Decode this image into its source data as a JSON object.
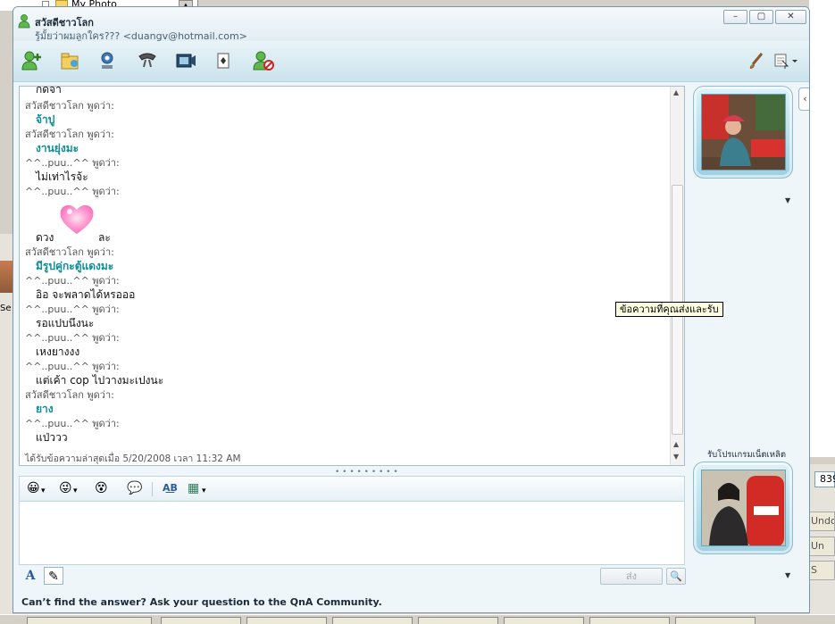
{
  "background": {
    "tree_item": "My Photo",
    "right_field_value": "839",
    "right_buttons": [
      "Undo",
      "Un",
      "S"
    ],
    "left_label": "Se"
  },
  "window": {
    "contact_name": "สวัสดีชาวโลก",
    "contact_message": "รู้มั้ยว่าผมลูกใคร??? <duangv@hotmail.com>",
    "buttons": {
      "minimize": "–",
      "maximize": "▢",
      "close": "✕"
    }
  },
  "toolbar": {
    "icons": [
      "invite-contact-icon",
      "share-files-icon",
      "video-call-icon",
      "phone-call-icon",
      "activities-icon",
      "games-icon",
      "block-icon",
      "paint-brush-icon",
      "display-options-icon"
    ]
  },
  "history": {
    "lines": [
      {
        "type": "msg",
        "text": "กดจา",
        "style": ""
      },
      {
        "type": "sender",
        "text": "สวัสดีชาวโลก พูดว่า:"
      },
      {
        "type": "msg",
        "text": "จ้าปู",
        "style": "teal"
      },
      {
        "type": "sender",
        "text": "สวัสดีชาวโลก พูดว่า:"
      },
      {
        "type": "msg",
        "text": "งานยุ่งมะ",
        "style": "teal"
      },
      {
        "type": "sender",
        "text": "^^..puu..^^ พูดว่า:"
      },
      {
        "type": "msg",
        "text": "ไม่เท่าไรจ้ะ",
        "style": ""
      },
      {
        "type": "sender",
        "text": "^^..puu..^^ พูดว่า:"
      },
      {
        "type": "msg_emoticon",
        "text_before": "ดวง",
        "text_after": "ละ",
        "emoticon": "heart-emoticon"
      },
      {
        "type": "sender",
        "text": "สวัสดีชาวโลก พูดว่า:"
      },
      {
        "type": "msg",
        "text": "มีรูปคู่กะตู้แดงมะ",
        "style": "teal"
      },
      {
        "type": "sender",
        "text": "^^..puu..^^ พูดว่า:"
      },
      {
        "type": "msg",
        "text": "อิอ จะพลาดได้หรอออ",
        "style": ""
      },
      {
        "type": "sender",
        "text": "^^..puu..^^ พูดว่า:"
      },
      {
        "type": "msg",
        "text": "รอแปบนึงนะ",
        "style": ""
      },
      {
        "type": "sender",
        "text": "^^..puu..^^ พูดว่า:"
      },
      {
        "type": "msg",
        "text": "เหงยางงง",
        "style": ""
      },
      {
        "type": "sender",
        "text": "^^..puu..^^ พูดว่า:"
      },
      {
        "type": "msg",
        "text": "แต่เค้า cop ไปวางมะเปงนะ",
        "style": ""
      },
      {
        "type": "sender",
        "text": "สวัสดีชาวโลก พูดว่า:"
      },
      {
        "type": "msg",
        "text": "ยาง",
        "style": "teal"
      },
      {
        "type": "sender",
        "text": "^^..puu..^^ พูดว่า:"
      },
      {
        "type": "msg",
        "text": "แป่ววว",
        "style": ""
      }
    ],
    "status": "ได้รับข้อความล่าสุดเมื่อ 5/20/2008 เวลา 11:32 AM"
  },
  "tooltip": "ข้อความที่คุณส่งและรับ",
  "splitter": "• • • • • • • • •",
  "compose_toolbar": {
    "emoticon_icon": "😀",
    "wink_icon": "😜",
    "nudge_icon": "😵",
    "voice_clip_icon": "💬",
    "translate_label": "A͟B",
    "background_icon": "▦",
    "dropdown": "▾"
  },
  "compose": {
    "value": "",
    "font_button": "A",
    "handwriting_button": "✎",
    "send_label": "ส่ง",
    "search_label": "🔍"
  },
  "sidebar": {
    "program_caption": "รับโปรแกรมเน็ตเหลิต"
  },
  "bottom_bar": {
    "text": "Can’t find the answer?  Ask your question to the QnA Community."
  }
}
